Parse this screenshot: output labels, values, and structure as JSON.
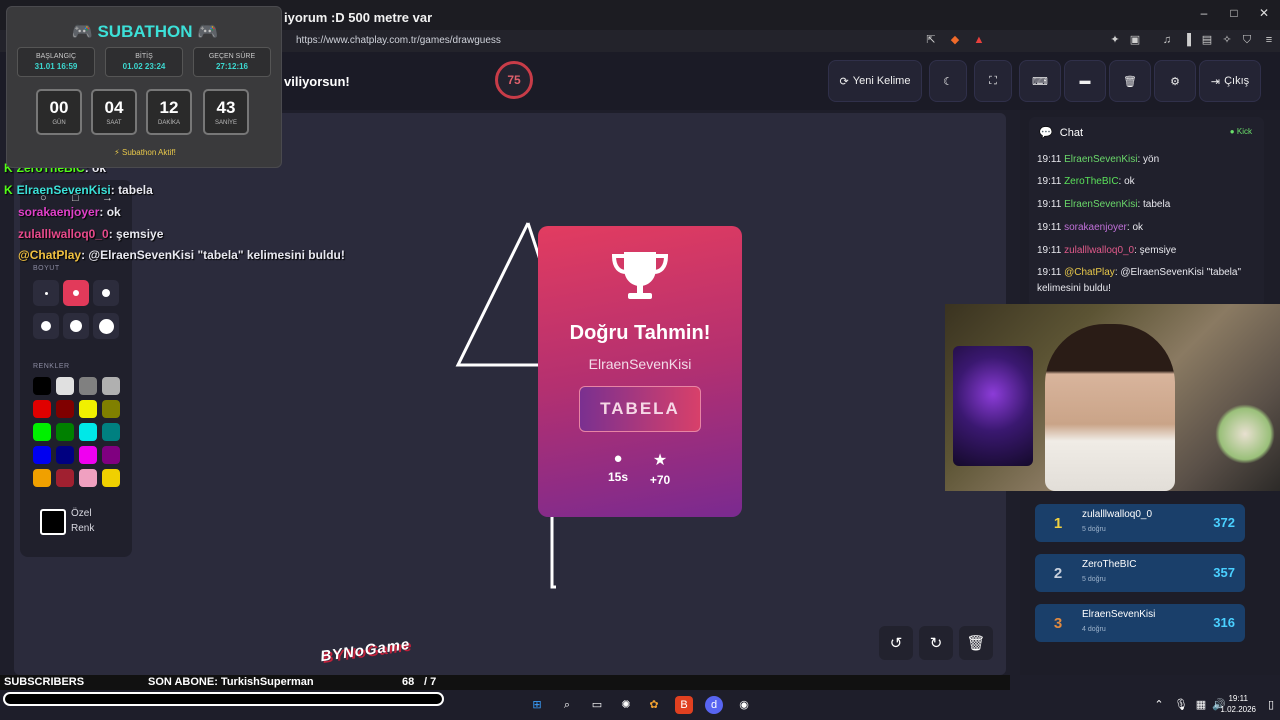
{
  "browser": {
    "title": "iyorum :D 500 metre var",
    "url": "https://www.chatplay.com.tr/games/drawguess"
  },
  "header": {
    "partial_text": "viliyorsun!",
    "timer": "75",
    "new_word_label": "Yeni Kelime",
    "exit_label": "Çıkış"
  },
  "subathon": {
    "title": "SUBATHON",
    "start_label": "BAŞLANGIÇ",
    "start_value": "31.01 16:59",
    "end_label": "BİTİŞ",
    "end_value": "01.02 23:24",
    "elapsed_label": "GEÇEN SÜRE",
    "elapsed_value": "27:12:16",
    "countdown": [
      {
        "value": "00",
        "unit": "GÜN"
      },
      {
        "value": "04",
        "unit": "SAAT"
      },
      {
        "value": "12",
        "unit": "DAKİKA"
      },
      {
        "value": "43",
        "unit": "SANİYE"
      }
    ],
    "status": "Subathon Aktif!"
  },
  "overlay_chat": [
    {
      "user": "ZeroTheBIC",
      "text": ": ok",
      "color": "#53fc18"
    },
    {
      "user": "ElraenSevenKisi",
      "text": ": tabela",
      "color": "#3ce0d8"
    },
    {
      "user": "sorakaenjoyer",
      "text": ": ok",
      "color": "#e040c8"
    },
    {
      "user": "zulalllwalloq0_0",
      "text": ": şemsiye",
      "color": "#e84a8c"
    },
    {
      "user": "@ChatPlay",
      "text": ": @ElraenSevenKisi \"tabela\" kelimesini buldu!",
      "color": "#f0c040"
    }
  ],
  "tools": {
    "size_label": "BOYUT",
    "colors_label": "RENKLER",
    "custom_label_1": "Özel",
    "custom_label_2": "Renk",
    "palette": [
      "#000000",
      "#e0e0e0",
      "#808080",
      "#b0b0b0",
      "#e00000",
      "#800000",
      "#f0f000",
      "#808000",
      "#00f000",
      "#008000",
      "#00e8e8",
      "#008080",
      "#0000f0",
      "#000080",
      "#f000f0",
      "#800080",
      "#f0a000",
      "#a02030",
      "#f0a0c0",
      "#f0d000"
    ]
  },
  "card": {
    "title": "Doğru Tahmin!",
    "user": "ElraenSevenKisi",
    "word": "TABELA",
    "time": "15s",
    "points": "+70"
  },
  "chat": {
    "title": "Chat",
    "source": "Kick",
    "messages": [
      {
        "time": "19:11",
        "user": "ElraenSevenKisi",
        "text": ": yön",
        "color": "#6ad86a"
      },
      {
        "time": "19:11",
        "user": "ZeroTheBIC",
        "text": ": ok",
        "color": "#5ae05a"
      },
      {
        "time": "19:11",
        "user": "ElraenSevenKisi",
        "text": ": tabela",
        "color": "#6ad86a"
      },
      {
        "time": "19:11",
        "user": "sorakaenjoyer",
        "text": ": ok",
        "color": "#c070d8"
      },
      {
        "time": "19:11",
        "user": "zulalllwalloq0_0",
        "text": ": şemsiye",
        "color": "#e05a8a"
      },
      {
        "time": "19:11",
        "user": "@ChatPlay",
        "text": ": @ElraenSevenKisi \"tabela\" kelimesini buldu!",
        "color": "#e8c84a"
      }
    ]
  },
  "leaderboard": [
    {
      "rank": "1",
      "name": "zulalllwalloq0_0",
      "sub": "5 doğru",
      "score": "372",
      "rank_color": "#f0d040"
    },
    {
      "rank": "2",
      "name": "ZeroTheBIC",
      "sub": "5 doğru",
      "score": "357",
      "rank_color": "#c8d0dc"
    },
    {
      "rank": "3",
      "name": "ElraenSevenKisi",
      "sub": "4 doğru",
      "score": "316",
      "rank_color": "#e08a40"
    }
  ],
  "streambar": {
    "subscribers_label": "SUBSCRIBERS",
    "last_sub": "SON ABONE: TurkishSuperman",
    "count": "68",
    "goal": "/ 7",
    "logo": "BYNoGame"
  },
  "taskbar": {
    "time": "19:11",
    "date": "1.02.2026"
  }
}
